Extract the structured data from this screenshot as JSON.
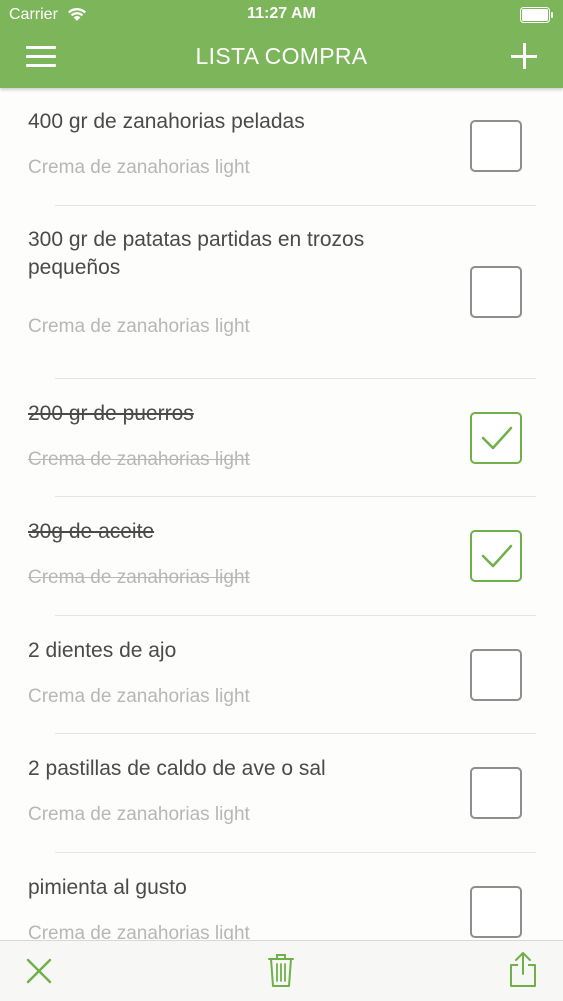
{
  "status_bar": {
    "carrier": "Carrier",
    "time": "11:27 AM"
  },
  "nav": {
    "title": "LISTA COMPRA",
    "menu_icon": "hamburger-menu-icon",
    "add_icon": "plus-icon"
  },
  "items": [
    {
      "name": "400 gr de zanahorias peladas",
      "recipe": "Crema de zanahorias light",
      "checked": false
    },
    {
      "name": "300 gr de patatas partidas en trozos pequeños",
      "recipe": "Crema de zanahorias light",
      "checked": false
    },
    {
      "name": "200 gr de puerros",
      "recipe": "Crema de zanahorias light",
      "checked": true
    },
    {
      "name": "30g de aceite",
      "recipe": "Crema de zanahorias light",
      "checked": true
    },
    {
      "name": "2 dientes de ajo",
      "recipe": "Crema de zanahorias light",
      "checked": false
    },
    {
      "name": "2 pastillas de caldo de ave o sal",
      "recipe": "Crema de zanahorias light",
      "checked": false
    },
    {
      "name": "pimienta al gusto",
      "recipe": "Crema de zanahorias light",
      "checked": false
    }
  ],
  "toolbar": {
    "close_icon": "close-x-icon",
    "delete_icon": "trash-icon",
    "share_icon": "share-icon"
  },
  "colors": {
    "accent": "#7cb55a",
    "check": "#6fb04a",
    "text": "#4a4a4a",
    "subtext": "#b7b7b7"
  }
}
